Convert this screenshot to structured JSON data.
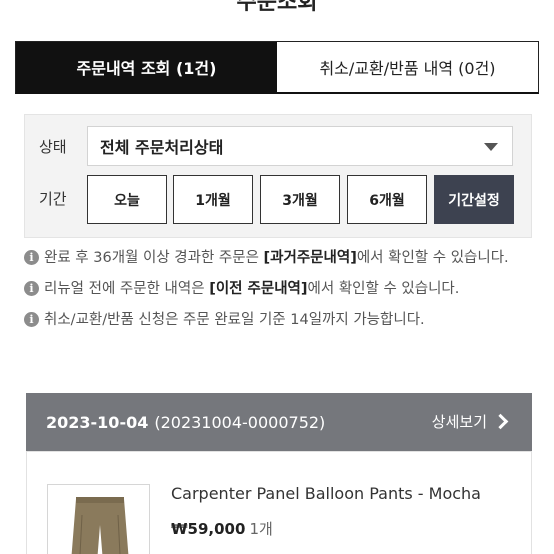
{
  "page": {
    "title": "주문조회"
  },
  "tabs": [
    {
      "label": "주문내역 조회 (1건)"
    },
    {
      "label": "취소/교환/반품 내역 (0건)"
    }
  ],
  "filter": {
    "status_label": "상태",
    "status_value": "전체 주문처리상태",
    "period_label": "기간",
    "periods": [
      "오늘",
      "1개월",
      "3개월",
      "6개월"
    ],
    "custom_period": "기간설정"
  },
  "notes": [
    {
      "pre": "완료 후 36개월 이상 경과한 주문은 ",
      "strong": "[과거주문내역]",
      "post": "에서 확인할 수 있습니다."
    },
    {
      "pre": "리뉴얼 전에 주문한 내역은 ",
      "strong": "[이전 주문내역]",
      "post": "에서 확인할 수 있습니다."
    },
    {
      "pre": "취소/교환/반품 신청은 주문 완료일 기준 14일까지 가능합니다.",
      "strong": "",
      "post": ""
    }
  ],
  "order": {
    "date": "2023-10-04",
    "number": "(20231004-0000752)",
    "detail_label": "상세보기",
    "product_name": "Carpenter Panel Balloon Pants - Mocha",
    "price": "₩59,000",
    "quantity": "1개"
  },
  "colors": {
    "tab_active_bg": "#111111",
    "header_bg": "#75777c",
    "custom_period_bg": "#3d4250"
  }
}
